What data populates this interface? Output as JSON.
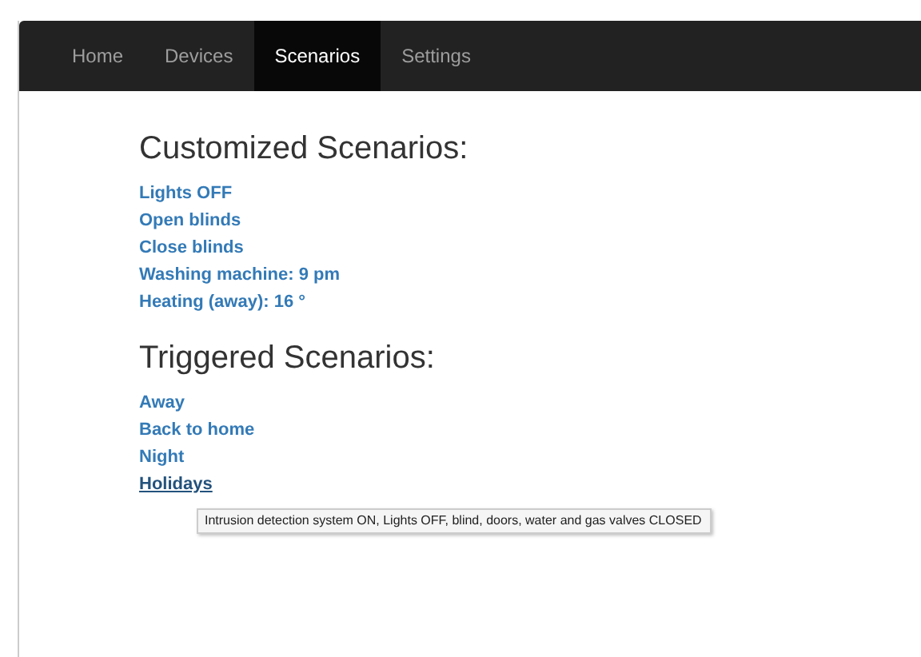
{
  "nav": [
    {
      "label": "Home",
      "selected": false
    },
    {
      "label": "Devices",
      "selected": false
    },
    {
      "label": "Scenarios",
      "selected": true
    },
    {
      "label": "Settings",
      "selected": false
    }
  ],
  "sections": [
    {
      "title": "Customized Scenarios:",
      "items": [
        {
          "label": "Lights OFF",
          "hovered": false
        },
        {
          "label": "Open blinds",
          "hovered": false
        },
        {
          "label": "Close blinds",
          "hovered": false
        },
        {
          "label": "Washing machine: 9 pm",
          "hovered": false
        },
        {
          "label": "Heating (away): 16 °",
          "hovered": false
        }
      ]
    },
    {
      "title": "Triggered Scenarios:",
      "items": [
        {
          "label": "Away",
          "hovered": false
        },
        {
          "label": "Back to home",
          "hovered": false
        },
        {
          "label": "Night",
          "hovered": false
        },
        {
          "label": "Holidays",
          "hovered": true,
          "tooltip": "Intrusion detection system ON, Lights OFF, blind, doors, water and gas valves CLOSED"
        }
      ]
    }
  ]
}
